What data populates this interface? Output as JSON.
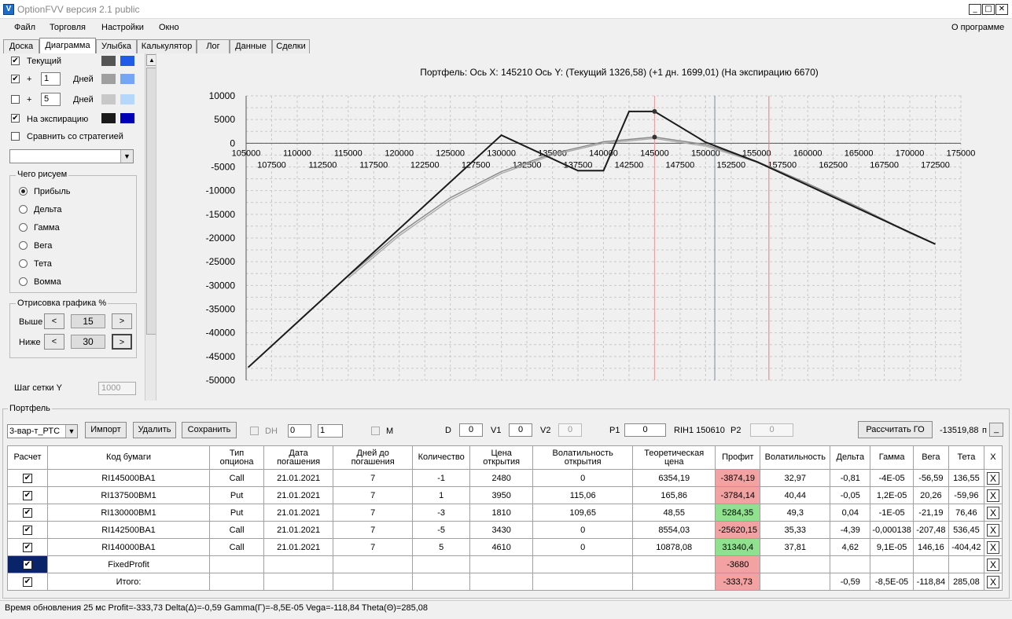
{
  "window": {
    "title": "OptionFVV версия 2.1 public",
    "icon_char": "V"
  },
  "menu": {
    "items": [
      "Файл",
      "Торговля",
      "Настройки",
      "Окно"
    ],
    "about": "О программе"
  },
  "tabs": [
    "Доска",
    "Диаграмма",
    "Улыбка",
    "Калькулятор",
    "Лог",
    "Данные",
    "Сделки"
  ],
  "left": {
    "current": {
      "label": "Текущий",
      "checked": "✔"
    },
    "plus1": {
      "plus": "+",
      "value": "1",
      "unit": "Дней",
      "checked": "✔"
    },
    "plus5": {
      "plus": "+",
      "value": "5",
      "unit": "Дней",
      "checked": ""
    },
    "expiry": {
      "label": "На экспирацию",
      "checked": "✔"
    },
    "compare": {
      "label": "Сравнить со стратегией",
      "checked": ""
    },
    "what_title": "Чего рисуем",
    "what": [
      "Прибыль",
      "Дельта",
      "Гамма",
      "Вега",
      "Тета",
      "Вомма"
    ],
    "draw_title": "Отрисовка графика %",
    "above_label": "Выше",
    "above_value": "15",
    "below_label": "Ниже",
    "below_value": "30",
    "left_arrow": "<",
    "right_arrow": ">",
    "grid_y_label": "Шаг сетки Y",
    "grid_y_value": "1000",
    "dropdown_arrow": "▼",
    "scroll_up": "▲",
    "colors": {
      "current": [
        "#555555",
        "#1f5be8"
      ],
      "plus1": [
        "#a0a0a0",
        "#74a6f5"
      ],
      "plus5": [
        "#c8c8c8",
        "#b4d7fb"
      ],
      "expiry": [
        "#1a1a1a",
        "#0000b4"
      ]
    }
  },
  "chart_data": {
    "type": "line",
    "title": "Портфель: Ось X: 145210 Ось Y:  (Текущий 1326,58)  (+1 дн. 1699,01)  (На экспирацию 6670)",
    "xlim": [
      105000,
      175000
    ],
    "ylim": [
      -50000,
      10000
    ],
    "x_ticks_top": [
      "105000",
      "110000",
      "115000",
      "120000",
      "125000",
      "130000",
      "135000",
      "140000",
      "145000",
      "150000",
      "155000",
      "160000",
      "165000",
      "170000",
      "175000"
    ],
    "x_ticks_bottom": [
      "107500",
      "112500",
      "117500",
      "122500",
      "127500",
      "132500",
      "137500",
      "142500",
      "147500",
      "152500",
      "157500",
      "162500",
      "167500",
      "172500"
    ],
    "y_ticks": [
      "10000",
      "5000",
      "0",
      "-5000",
      "-10000",
      "-15000",
      "-20000",
      "-25000",
      "-30000",
      "-35000",
      "-40000",
      "-45000",
      "-50000"
    ],
    "x_ticks_top_values": [
      105000,
      110000,
      115000,
      120000,
      125000,
      130000,
      135000,
      140000,
      145000,
      150000,
      155000,
      160000,
      165000,
      170000,
      175000
    ],
    "x_ticks_bottom_values": [
      107500,
      112500,
      117500,
      122500,
      127500,
      132500,
      137500,
      142500,
      147500,
      152500,
      157500,
      162500,
      167500,
      172500
    ],
    "y_ticks_values": [
      10000,
      5000,
      0,
      -5000,
      -10000,
      -15000,
      -20000,
      -25000,
      -30000,
      -35000,
      -40000,
      -45000,
      -50000
    ],
    "series": [
      {
        "color": "#1a1a1a",
        "x": [
          105200,
          130000,
          137500,
          140000,
          142500,
          145000,
          150000,
          155000,
          172500
        ],
        "y": [
          -47300,
          1700,
          -5800,
          -5800,
          6700,
          6700,
          200,
          -3900,
          -21300
        ]
      },
      {
        "color": "#888888",
        "x": [
          115000,
          120000,
          125000,
          130000,
          135000,
          140000,
          145000,
          150000,
          155000,
          160000,
          165000,
          170000,
          172500
        ],
        "y": [
          -28000,
          -19000,
          -11500,
          -6000,
          -2200,
          300,
          1300,
          -300,
          -3800,
          -8500,
          -13500,
          -18800,
          -21300
        ]
      },
      {
        "color": "#aaaaaa",
        "x": [
          115000,
          120000,
          125000,
          130000,
          135000,
          140000,
          145000,
          150000,
          155000,
          160000,
          165000,
          170000,
          172500
        ],
        "y": [
          -28500,
          -19500,
          -12000,
          -6400,
          -2500,
          0,
          1000,
          -600,
          -4000,
          -8700,
          -13700,
          -19000,
          -21300
        ]
      }
    ],
    "markers": [
      {
        "x": 145000,
        "y": 6700
      },
      {
        "x": 145000,
        "y": 1300
      }
    ],
    "vlines": [
      {
        "x": 150900,
        "color": "#7a8aa0"
      },
      {
        "x": 156200,
        "color": "#ee7777"
      },
      {
        "x": 145000,
        "color": "#ee9999"
      }
    ]
  },
  "portfolio": {
    "title": "Портфель",
    "combo": "3-вар-т_РТС",
    "import": "Импорт",
    "delete": "Удалить",
    "save": "Сохранить",
    "dh": "DH",
    "dh_val1": "0",
    "dh_val2": "1",
    "m": "M",
    "d_label": "D",
    "d_val": "0",
    "v1_label": "V1",
    "v1_val": "0",
    "v2_label": "V2",
    "v2_val": "0",
    "p1_label": "P1",
    "p1_val": "0",
    "ticker": "RIH1 150610",
    "p2_label": "P2",
    "p2_val": "0",
    "calc": "Рассчитать ГО",
    "go_value": "-13519,88",
    "go_suffix": "п",
    "go_btn": "_"
  },
  "table": {
    "headers": [
      "Расчет",
      "Код бумаги",
      "Тип\nопциона",
      "Дата\nпогашения",
      "Дней до\nпогашения",
      "Количество",
      "Цена\nоткрытия",
      "Волатильность\nоткрытия",
      "Теоретическая\nцена",
      "Профит",
      "Волатильность",
      "Дельта",
      "Гамма",
      "Вега",
      "Тета",
      "X"
    ],
    "rows": [
      {
        "check": "✔",
        "code": "RI145000BA1",
        "type": "Call",
        "date": "21.01.2021",
        "days": "7",
        "qty": "-1",
        "price": "2480",
        "vol_open": "0",
        "theor": "6354,19",
        "profit": "-3874,19",
        "pcolor": "#f2a2a2",
        "vol": "32,97",
        "delta": "-0,81",
        "gamma": "-4E-05",
        "vega": "-56,59",
        "theta": "136,55",
        "x": "X"
      },
      {
        "check": "✔",
        "code": "RI137500BM1",
        "type": "Put",
        "date": "21.01.2021",
        "days": "7",
        "qty": "1",
        "price": "3950",
        "vol_open": "115,06",
        "theor": "165,86",
        "profit": "-3784,14",
        "pcolor": "#f2a2a2",
        "vol": "40,44",
        "delta": "-0,05",
        "gamma": "1,2E-05",
        "vega": "20,26",
        "theta": "-59,96",
        "x": "X"
      },
      {
        "check": "✔",
        "code": "RI130000BM1",
        "type": "Put",
        "date": "21.01.2021",
        "days": "7",
        "qty": "-3",
        "price": "1810",
        "vol_open": "109,65",
        "theor": "48,55",
        "profit": "5284,35",
        "pcolor": "#8fe08f",
        "vol": "49,3",
        "delta": "0,04",
        "gamma": "-1E-05",
        "vega": "-21,19",
        "theta": "76,46",
        "x": "X"
      },
      {
        "check": "✔",
        "code": "RI142500BA1",
        "type": "Call",
        "date": "21.01.2021",
        "days": "7",
        "qty": "-5",
        "price": "3430",
        "vol_open": "0",
        "theor": "8554,03",
        "profit": "-25620,15",
        "pcolor": "#f2a2a2",
        "vol": "35,33",
        "delta": "-4,39",
        "gamma": "-0,000138",
        "vega": "-207,48",
        "theta": "536,45",
        "x": "X"
      },
      {
        "check": "✔",
        "code": "RI140000BA1",
        "type": "Call",
        "date": "21.01.2021",
        "days": "7",
        "qty": "5",
        "price": "4610",
        "vol_open": "0",
        "theor": "10878,08",
        "profit": "31340,4",
        "pcolor": "#8fe08f",
        "vol": "37,81",
        "delta": "4,62",
        "gamma": "9,1E-05",
        "vega": "146,16",
        "theta": "-404,42",
        "x": "X"
      },
      {
        "check": "✔",
        "code": "FixedProfit",
        "type": "",
        "date": "",
        "days": "",
        "qty": "",
        "price": "",
        "vol_open": "",
        "theor": "",
        "profit": "-3680",
        "pcolor": "#f2a2a2",
        "vol": "",
        "delta": "",
        "gamma": "",
        "vega": "",
        "theta": "",
        "x": "X"
      },
      {
        "check": "✔",
        "code": "Итого:",
        "type": "",
        "date": "",
        "days": "",
        "qty": "",
        "price": "",
        "vol_open": "",
        "theor": "",
        "profit": "-333,73",
        "pcolor": "#f2a2a2",
        "vol": "",
        "delta": "-0,59",
        "gamma": "-8,5E-05",
        "vega": "-118,84",
        "theta": "285,08",
        "x": "X"
      }
    ]
  },
  "status": "Время обновления 25 мс  Profit=-333,73 Delta(Δ)=-0,59 Gamma(Γ)=-8,5E-05 Vega=-118,84 Theta(Θ)=285,08"
}
